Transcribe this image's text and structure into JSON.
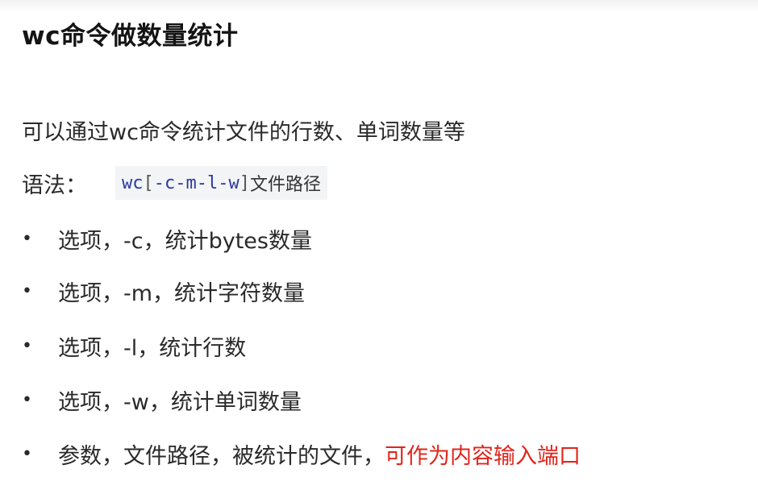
{
  "title": "wc命令做数量统计",
  "intro": "可以通过wc命令统计文件的行数、单词数量等",
  "syntax": {
    "label": "语法：",
    "cmd": "wc",
    "open_bracket": "[",
    "opt_c": "-c",
    "opt_m": "-m",
    "opt_l": "-l",
    "opt_w": "-w",
    "close_bracket": "]",
    "path": "文件路径"
  },
  "options": [
    {
      "bullet": "•",
      "text": "选项，-c，统计bytes数量"
    },
    {
      "bullet": "•",
      "text": "选项，-m，统计字符数量"
    },
    {
      "bullet": "•",
      "text": "选项，-l，统计行数"
    },
    {
      "bullet": "•",
      "text": "选项，-w，统计单词数量"
    },
    {
      "bullet": "•",
      "text": "参数，文件路径，被统计的文件，",
      "highlight": "可作为内容输入端口"
    }
  ],
  "colors": {
    "highlight": "#e1251b",
    "code_keyword": "#2b3a9e",
    "code_background": "#f3f4f6"
  }
}
